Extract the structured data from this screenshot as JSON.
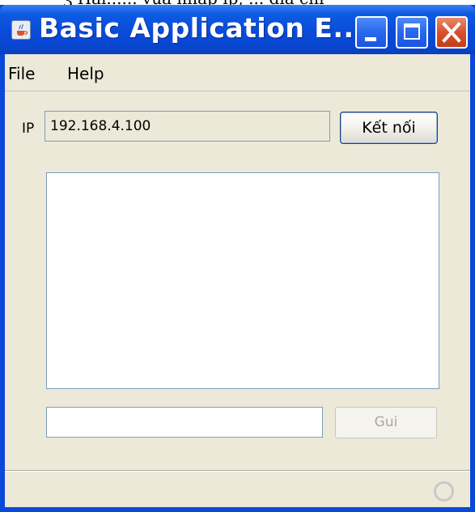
{
  "background_text": "ʒ Hai...... vua nhap ip, ... dia chi",
  "window": {
    "title": "Basic Application E...",
    "icon": "java-coffee-cup-icon",
    "controls": {
      "minimize": "minimize-icon",
      "maximize": "maximize-icon",
      "close": "close-icon"
    }
  },
  "menu": {
    "items": [
      {
        "label": "File"
      },
      {
        "label": "Help"
      }
    ]
  },
  "connection": {
    "ip_label": "IP",
    "ip_value": "192.168.4.100",
    "connect_label": "Kết nối"
  },
  "chat": {
    "log_text": "",
    "message_value": "",
    "send_label": "Gui",
    "send_enabled": false
  },
  "status": {
    "busy_icon": "busy-indicator-icon"
  },
  "colors": {
    "titlebar": "#0a4bd9",
    "window_bg": "#ece9d8",
    "close_button": "#d9502e",
    "field_border": "#7f9db9"
  }
}
